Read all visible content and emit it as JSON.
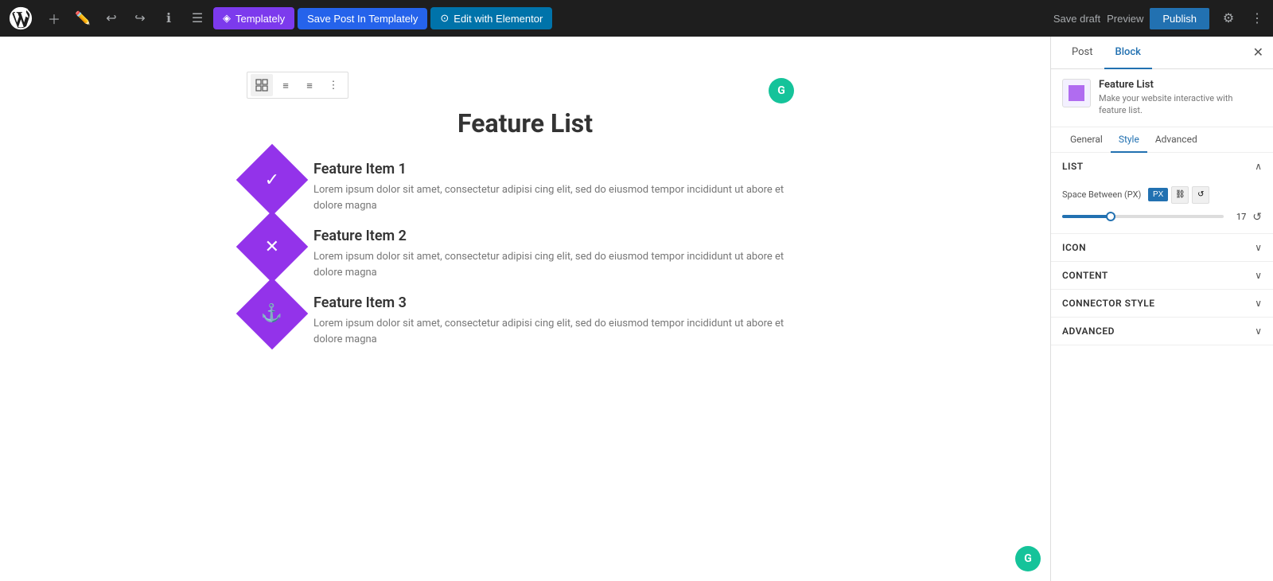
{
  "toolbar": {
    "templately_label": "Templately",
    "save_post_label": "Save Post In Templately",
    "elementor_label": "Edit with Elementor",
    "save_draft_label": "Save draft",
    "preview_label": "Preview",
    "publish_label": "Publish"
  },
  "canvas": {
    "title": "Feature List",
    "items": [
      {
        "title": "Feature Item 1",
        "desc": "Lorem ipsum dolor sit amet, consectetur adipisi cing elit, sed do eiusmod tempor incididunt ut abore et dolore magna",
        "icon": "✓"
      },
      {
        "title": "Feature Item 2",
        "desc": "Lorem ipsum dolor sit amet, consectetur adipisi cing elit, sed do eiusmod tempor incididunt ut abore et dolore magna",
        "icon": "✕"
      },
      {
        "title": "Feature Item 3",
        "desc": "Lorem ipsum dolor sit amet, consectetur adipisi cing elit, sed do eiusmod tempor incididunt ut abore et dolore magna",
        "icon": "⚓"
      }
    ]
  },
  "right_panel": {
    "tab_post": "Post",
    "tab_block": "Block",
    "active_tab": "Block",
    "plugin": {
      "name": "Feature List",
      "desc": "Make your website interactive with feature list."
    },
    "style_tabs": [
      {
        "label": "General",
        "active": false
      },
      {
        "label": "Style",
        "active": true
      },
      {
        "label": "Advanced",
        "active": false
      }
    ],
    "sections": {
      "list": {
        "title": "List",
        "space_between_label": "Space Between (PX)",
        "space_between_value": "17"
      },
      "icon": {
        "title": "Icon"
      },
      "content": {
        "title": "Content"
      },
      "connector_style": {
        "title": "Connector Style"
      },
      "advanced": {
        "title": "Advanced"
      }
    }
  },
  "colors": {
    "purple": "#9333ea",
    "blue": "#2271b1",
    "green": "#15c39a"
  }
}
